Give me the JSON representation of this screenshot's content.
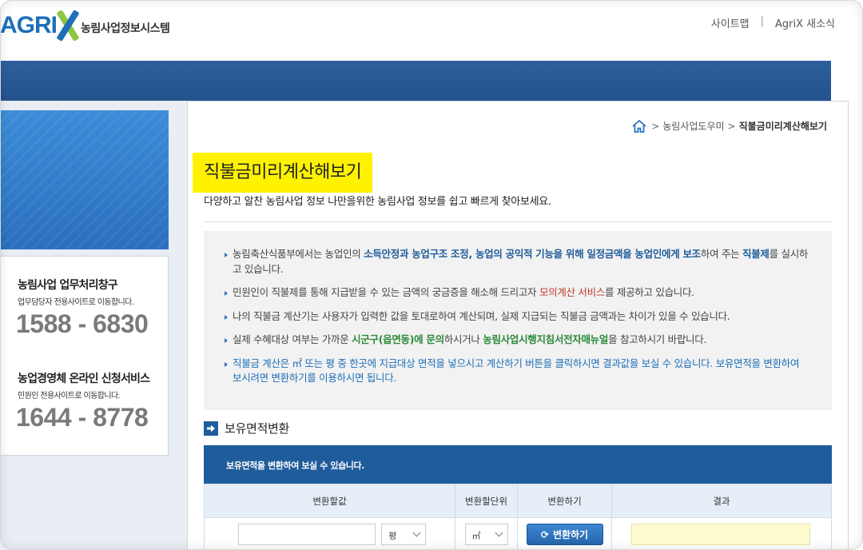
{
  "header": {
    "logo_text": "AGRI",
    "logo_sub": "농림사업정보시스템",
    "links": [
      "사이트맵",
      "AgriX 새소식"
    ],
    "separator": "|"
  },
  "sidebar": {
    "contact1": {
      "title": "농림사업 업무처리창구",
      "sub": "업무담당자 전용사이트로 이동합니다.",
      "phone": "1588 - 6830"
    },
    "contact2": {
      "title": "농업경영체 온라인 신청서비스",
      "sub": "민원인 전용사이트로 이동합니다.",
      "phone": "1644 - 8778"
    }
  },
  "breadcrumb": {
    "item1": "농림사업도우미",
    "current": "직불금미리계산해보기",
    "chev": ">"
  },
  "page": {
    "title": "직불금미리계산해보기",
    "desc": "다양하고 알찬 농림사업 정보 나만을위한 농림사업 정보를 쉽고 빠르게 찾아보세요."
  },
  "notice": {
    "l1_a": "농림축산식품부에서는 농업인의 ",
    "l1_b": "소득안정과 농업구조 조정, 농업의 공익적 기능을 위해 일정금액을 농업인에게 보조",
    "l1_c": "하여 주는 ",
    "l1_d": "직불제",
    "l1_e": "를 실시하고 있습니다.",
    "l2_a": "민원인이 직불제를 통해 지급받을 수 있는 금액의 궁금증을 해소해 드리고자 ",
    "l2_b": "모의계산 서비스",
    "l2_c": "를 제공하고 있습니다.",
    "l3": "나의 직불금 계산기는 사용자가 입력한 값을 토대로하여 계산되며, 실제 지급되는 직불금 금액과는 차이가 있을 수 있습니다.",
    "l4_a": "실제 수혜대상 여부는 가까운 ",
    "l4_b": "시군구(읍면동)에 문의",
    "l4_c": "하시거나 ",
    "l4_d": "농림사업시행지침서전자매뉴얼",
    "l4_e": "을 참고하시기 바랍니다.",
    "l5": "직불금 계산은 ㎡ 또는 평 중 한곳에 지급대상 면적을 넣으시고 계산하기 버튼을 클릭하시면 결과값을 보실 수 있습니다. 보유면적을 변환하여 보시려면 변환하기를 이용하시면 됩니다."
  },
  "converter": {
    "section_title": "보유면적변환",
    "head_text": "보유면적을 변환하여 보실 수 있습니다.",
    "columns": [
      "변환할값",
      "변환할단위",
      "변환하기",
      "결과"
    ],
    "value_input": "",
    "unit_from": "평",
    "unit_to": "㎡",
    "button_label": "변환하기",
    "result": ""
  },
  "colors": {
    "brand_blue": "#1e6fb8",
    "brand_green": "#8dc63f",
    "highlight": "#fff200"
  }
}
